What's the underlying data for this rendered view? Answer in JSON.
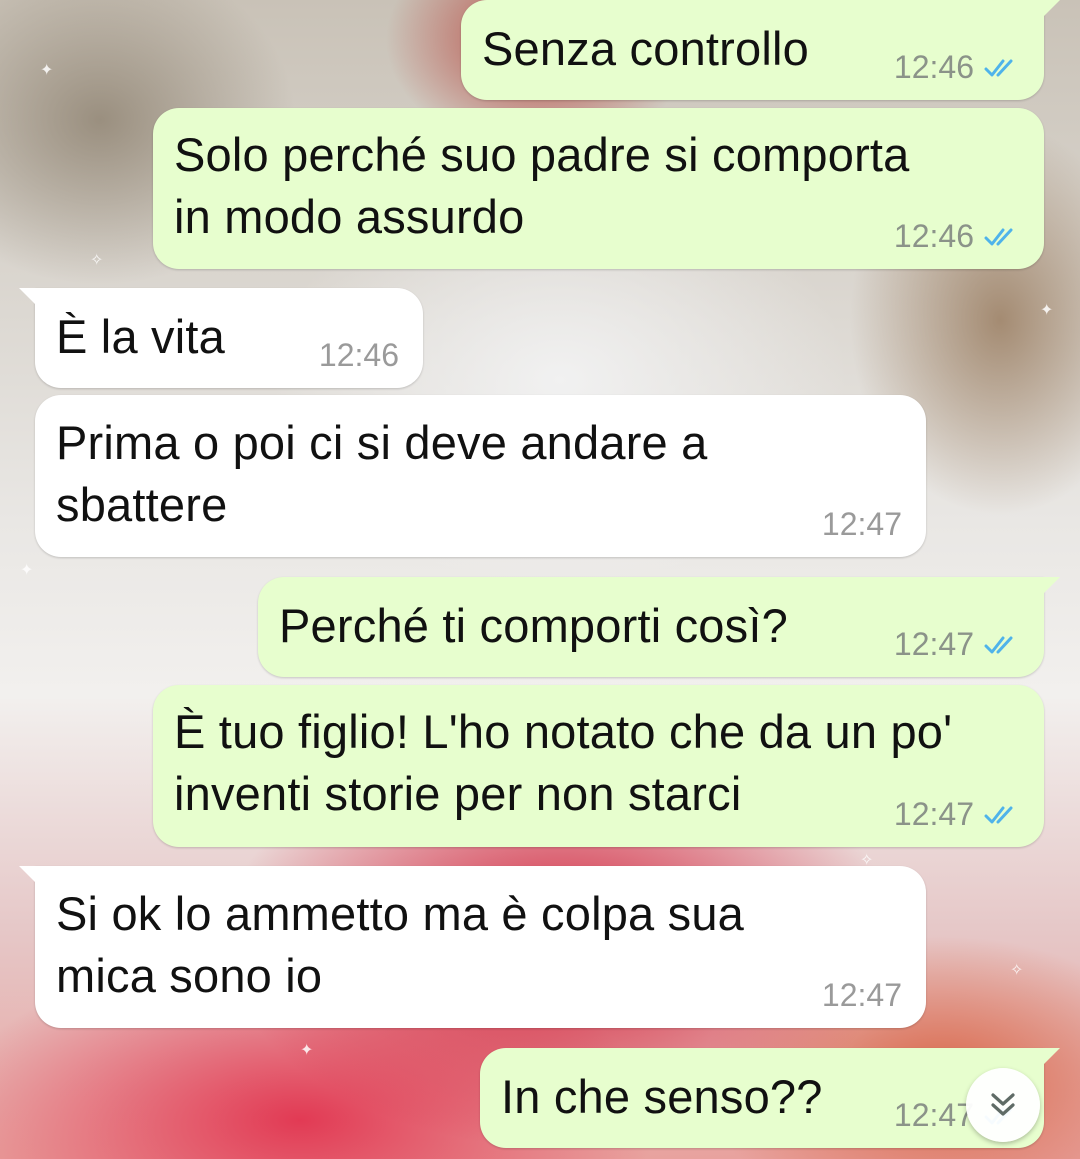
{
  "chat": {
    "accent_read_ticks": "#4fb3ea",
    "outgoing_bubble_color": "#e7fece",
    "incoming_bubble_color": "#ffffff",
    "messages": [
      {
        "direction": "outgoing",
        "text": "Senza controllo",
        "time": "12:46",
        "status": "read"
      },
      {
        "direction": "outgoing",
        "text": "Solo perché suo padre si comporta\nin modo assurdo",
        "time": "12:46",
        "status": "read"
      },
      {
        "direction": "incoming",
        "text": "È la vita",
        "time": "12:46"
      },
      {
        "direction": "incoming",
        "text": "Prima o poi ci si deve andare a\nsbattere",
        "time": "12:47"
      },
      {
        "direction": "outgoing",
        "text": "Perché ti comporti così?",
        "time": "12:47",
        "status": "read"
      },
      {
        "direction": "outgoing",
        "text": "È tuo figlio! L'ho notato che da un po'\ninventi storie per non starci",
        "time": "12:47",
        "status": "read"
      },
      {
        "direction": "incoming",
        "text": "Si ok lo ammetto ma è colpa sua\nmica sono io",
        "time": "12:47"
      },
      {
        "direction": "outgoing",
        "text": "In che senso??",
        "time": "12:47",
        "status": "read"
      }
    ]
  },
  "scroll_to_bottom_icon": "double-chevron-down-icon"
}
